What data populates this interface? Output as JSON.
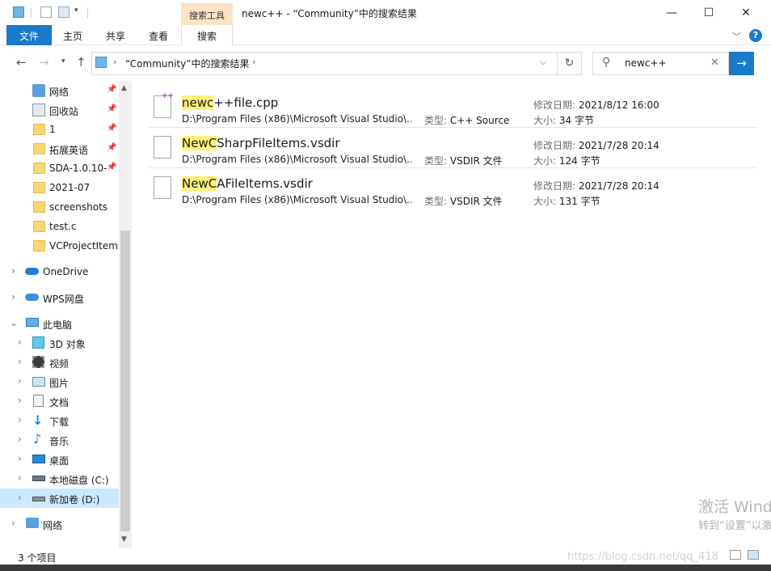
{
  "window": {
    "title": "newc++ - “Community”中的搜索结果",
    "context_tab": "搜索工具",
    "minimize": "—",
    "maximize": "☐",
    "close": "✕"
  },
  "ribbon": {
    "tabs": [
      "文件",
      "主页",
      "共享",
      "查看",
      "搜索"
    ],
    "active": "搜索",
    "accent": "#1979ca",
    "help": "?"
  },
  "nav": {
    "address": "“Community”中的搜索结果",
    "search_query": "newc++"
  },
  "sidebar": {
    "quick_access": [
      {
        "label": "网络",
        "icon": "network-icon",
        "pinned": true
      },
      {
        "label": "回收站",
        "icon": "recycle-bin-icon",
        "pinned": true
      },
      {
        "label": "1",
        "icon": "folder-icon",
        "pinned": true
      },
      {
        "label": "拓展英语",
        "icon": "folder-icon",
        "pinned": true
      },
      {
        "label": "SDA-1.0.10-:",
        "icon": "folder-icon",
        "pinned": true
      },
      {
        "label": "2021-07",
        "icon": "folder-icon",
        "pinned": false
      },
      {
        "label": "screenshots",
        "icon": "folder-icon",
        "pinned": false
      },
      {
        "label": "test.c",
        "icon": "folder-icon",
        "pinned": false
      },
      {
        "label": "VCProjectItems",
        "icon": "folder-icon",
        "pinned": false
      }
    ],
    "roots": [
      {
        "label": "OneDrive",
        "icon": "onedrive-icon"
      },
      {
        "label": "WPS网盘",
        "icon": "wps-cloud-icon"
      },
      {
        "label": "此电脑",
        "icon": "this-pc-icon"
      }
    ],
    "pc_children": [
      {
        "label": "3D 对象",
        "icon": "3d-objects-icon"
      },
      {
        "label": "视频",
        "icon": "videos-icon"
      },
      {
        "label": "图片",
        "icon": "pictures-icon"
      },
      {
        "label": "文档",
        "icon": "documents-icon"
      },
      {
        "label": "下载",
        "icon": "downloads-icon"
      },
      {
        "label": "音乐",
        "icon": "music-icon"
      },
      {
        "label": "桌面",
        "icon": "desktop-icon"
      },
      {
        "label": "本地磁盘 (C:)",
        "icon": "drive-c-icon"
      },
      {
        "label": "新加卷 (D:)",
        "icon": "drive-d-icon",
        "selected": true
      }
    ],
    "network": {
      "label": "网络",
      "icon": "network-icon"
    }
  },
  "results": [
    {
      "match": "newc",
      "rest": "++file.cpp",
      "path": "D:\\Program Files (x86)\\Microsoft Visual Studio\\...",
      "type_label": "类型:",
      "type": "C++ Source",
      "date_label": "修改日期:",
      "date": "2021/8/12 16:00",
      "size_label": "大小:",
      "size": "34 字节",
      "icon": "cpp-file-icon"
    },
    {
      "match": "NewC",
      "rest": "SharpFileItems.vsdir",
      "path": "D:\\Program Files (x86)\\Microsoft Visual Studio\\...",
      "type_label": "类型:",
      "type": "VSDIR 文件",
      "date_label": "修改日期:",
      "date": "2021/7/28 20:14",
      "size_label": "大小:",
      "size": "124 字节",
      "icon": "file-icon"
    },
    {
      "match": "NewC",
      "rest": "AFileItems.vsdir",
      "path": "D:\\Program Files (x86)\\Microsoft Visual Studio\\...",
      "type_label": "类型:",
      "type": "VSDIR 文件",
      "date_label": "修改日期:",
      "date": "2021/7/28 20:14",
      "size_label": "大小:",
      "size": "131 字节",
      "icon": "file-icon"
    }
  ],
  "status": {
    "count": "3 个项目"
  },
  "overlay": {
    "activation_line1": "激活 Wind",
    "activation_line2": "转到“设置”以激",
    "csdn": "https://blog.csdn.net/qq_418"
  }
}
